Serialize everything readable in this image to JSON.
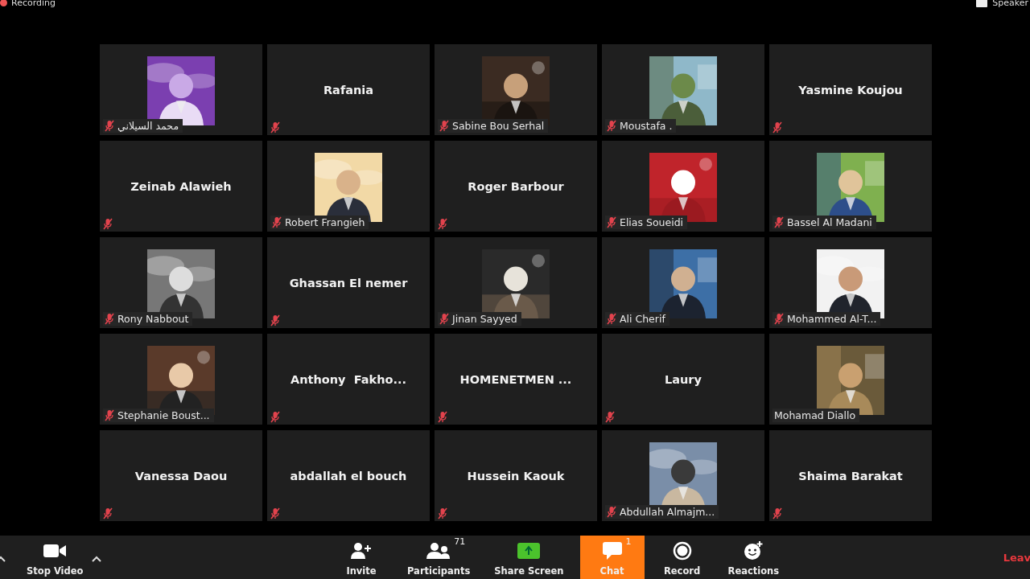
{
  "recording": {
    "label": "Recording"
  },
  "view_button": {
    "label": "Speaker"
  },
  "tiles": [
    {
      "name": "محمد السيلاني",
      "kind": "picture",
      "muted": true
    },
    {
      "name": "Rafania",
      "kind": "name",
      "muted": true
    },
    {
      "name": "Sabine Bou Serhal",
      "kind": "picture",
      "muted": true
    },
    {
      "name": "Moustafa .",
      "kind": "picture",
      "muted": true
    },
    {
      "name": "Yasmine Koujou",
      "kind": "name",
      "muted": true
    },
    {
      "name": "Zeinab Alawieh",
      "kind": "name",
      "muted": true
    },
    {
      "name": "Robert Frangieh",
      "kind": "picture",
      "muted": true
    },
    {
      "name": "Roger Barbour",
      "kind": "name",
      "muted": true
    },
    {
      "name": "Elias Soueidi",
      "kind": "picture",
      "muted": true
    },
    {
      "name": "Bassel Al Madani",
      "kind": "picture",
      "muted": true
    },
    {
      "name": "Rony Nabbout",
      "kind": "picture",
      "muted": true
    },
    {
      "name": "Ghassan El nemer",
      "kind": "name",
      "muted": true
    },
    {
      "name": "Jinan Sayyed",
      "kind": "picture",
      "muted": true
    },
    {
      "name": "Ali Cherif",
      "kind": "picture",
      "muted": true
    },
    {
      "name": "Mohammed Al-T...",
      "kind": "picture",
      "muted": true
    },
    {
      "name": "Stephanie Boust...",
      "kind": "picture",
      "muted": true
    },
    {
      "name": "Anthony  Fakho...",
      "kind": "name",
      "muted": true
    },
    {
      "name": "HOMENETMEN ...",
      "kind": "name",
      "muted": true
    },
    {
      "name": "Laury",
      "kind": "name",
      "muted": true
    },
    {
      "name": "Mohamad Diallo",
      "kind": "picture",
      "muted": false
    },
    {
      "name": "Vanessa Daou",
      "kind": "name",
      "muted": true
    },
    {
      "name": "abdallah el bouch",
      "kind": "name",
      "muted": true
    },
    {
      "name": "Hussein Kaouk",
      "kind": "name",
      "muted": true
    },
    {
      "name": "Abdullah Almajm...",
      "kind": "picture",
      "muted": true
    },
    {
      "name": "Shaima Barakat",
      "kind": "name",
      "muted": true
    }
  ],
  "toolbar": {
    "left": [
      {
        "kind": "video",
        "label": "Stop Video",
        "selected": false
      }
    ],
    "center": [
      {
        "kind": "invite",
        "label": "Invite",
        "selected": false
      },
      {
        "kind": "participants",
        "label": "Participants",
        "badge": "71",
        "selected": false
      },
      {
        "kind": "share",
        "label": "Share Screen",
        "selected": false
      },
      {
        "kind": "chat",
        "label": "Chat",
        "badge": "1",
        "selected": true
      },
      {
        "kind": "record",
        "label": "Record",
        "selected": false
      },
      {
        "kind": "reactions",
        "label": "Reactions",
        "selected": false
      }
    ],
    "leave": {
      "label": "Leav"
    }
  }
}
